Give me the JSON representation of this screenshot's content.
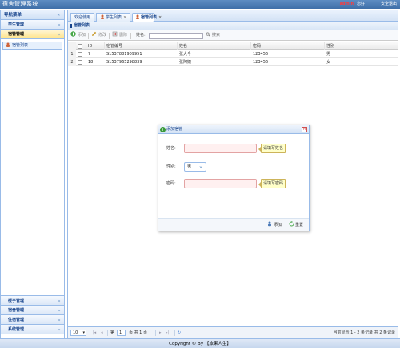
{
  "app": {
    "title": "宿舍管理系统",
    "username": "admin",
    "greeting": "您好",
    "logout": "安全退出"
  },
  "nav": {
    "title": "导航菜单",
    "collapse_icon": "«",
    "sections": [
      {
        "label": "学生管理",
        "chev": "»"
      },
      {
        "label": "宿管管理",
        "chev": "«"
      }
    ],
    "active_item": "宿管列表",
    "bottom_sections": [
      {
        "label": "楼宇管理",
        "chev": "»"
      },
      {
        "label": "宿舍管理",
        "chev": "»"
      },
      {
        "label": "住宿管理",
        "chev": "»"
      },
      {
        "label": "系统管理",
        "chev": "»"
      }
    ]
  },
  "tabs": [
    {
      "label": "欢迎使用"
    },
    {
      "label": "学生列表",
      "close": "×"
    },
    {
      "label": "宿管列表",
      "close": "×"
    }
  ],
  "grid": {
    "title": "宿管列表",
    "toolbar": {
      "add": "添加",
      "edit": "修改",
      "delete": "删除",
      "search_label": "姓名:",
      "search_placeholder": "",
      "search_btn": "搜索"
    },
    "columns": [
      "ID",
      "宿管编号",
      "姓名",
      "密码",
      "性别"
    ],
    "rows": [
      {
        "rn": "1",
        "id": "7",
        "code": "S1537881909951",
        "name": "张大今",
        "password": "123456",
        "gender": "男"
      },
      {
        "rn": "2",
        "id": "18",
        "code": "S1537965298839",
        "name": "张阿姨",
        "password": "123456",
        "gender": "女"
      }
    ]
  },
  "pager": {
    "page_size": "10",
    "page_prefix": "第",
    "page": "1",
    "page_suffix": "页 共 1 页",
    "info": "当前显示 1 - 2 条记录 共 2 条记录"
  },
  "footer": "Copyright © By 【旅果人生】",
  "dialog": {
    "title": "添加宿管",
    "close": "×",
    "name_label": "姓名:",
    "name_tip": "请填写姓名",
    "gender_label": "性别:",
    "gender_value": "男",
    "password_label": "密码:",
    "password_tip": "请填写密码",
    "add_btn": "添加",
    "reset_btn": "重置"
  },
  "colors": {
    "accent": "#5d8cc2",
    "border": "#99bbe8",
    "active_section": "#ffe38a"
  }
}
